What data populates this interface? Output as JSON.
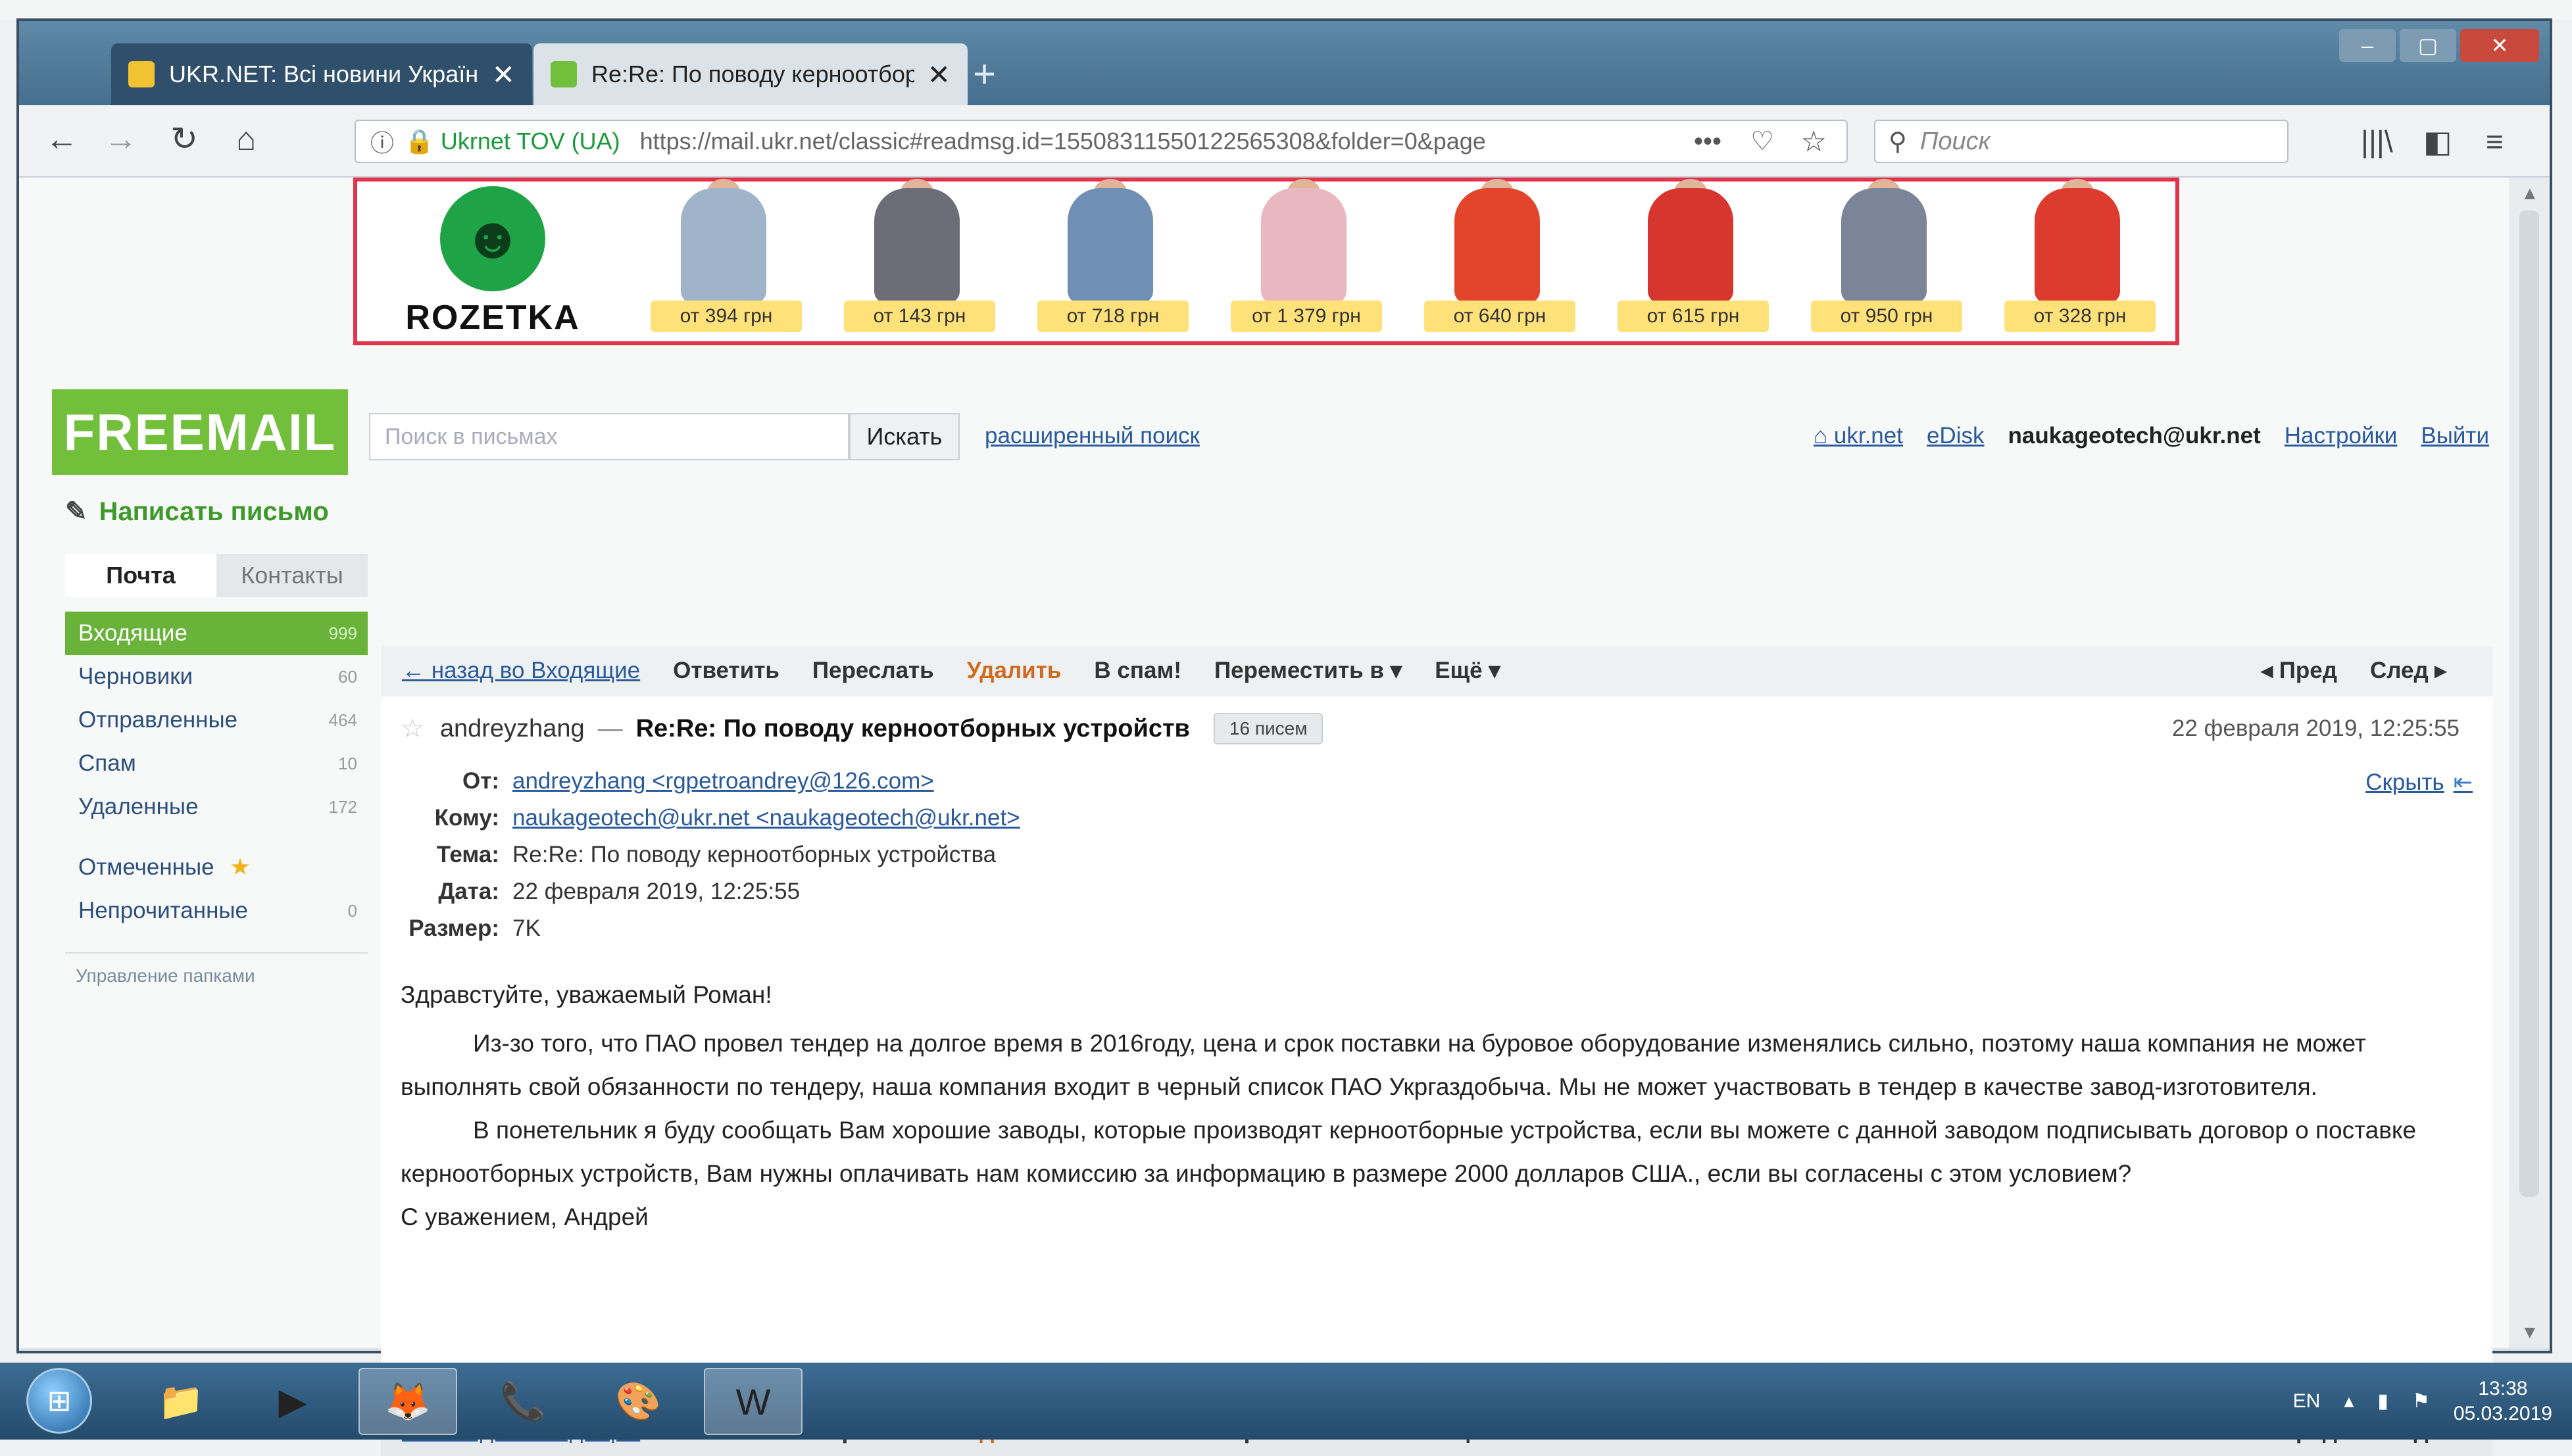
{
  "browser": {
    "tabs": [
      {
        "label": "UKR.NET: Всі новини Україн",
        "close": "✕"
      },
      {
        "label": "Re:Re: По поводу керноотбор",
        "close": "✕"
      }
    ],
    "new_tab": "+",
    "url_org": "Ukrnet TOV (UA)",
    "url": "https://mail.ukr.net/classic#readmsg.id=15508311550122565308&folder=0&page",
    "search_placeholder": "Поиск",
    "icons": [
      "back-icon",
      "forward-icon",
      "reload-icon",
      "home-icon",
      "lock-icon",
      "more-icon",
      "pocket-icon",
      "star-icon",
      "search-icon",
      "library-icon",
      "sidebar-icon",
      "menu-icon"
    ]
  },
  "banner": {
    "brand": "ROZETKA",
    "products": [
      {
        "price": "от 394 грн",
        "color": "#9fb3c9"
      },
      {
        "price": "от 143 грн",
        "color": "#6d6d78"
      },
      {
        "price": "от 718 грн",
        "color": "#6f8fb4"
      },
      {
        "price": "от 1 379 грн",
        "color": "#e9b7c0"
      },
      {
        "price": "от 640 грн",
        "color": "#e2452c"
      },
      {
        "price": "от 615 грн",
        "color": "#d7362e"
      },
      {
        "price": "от 950 грн",
        "color": "#7c8597"
      },
      {
        "price": "от 328 грн",
        "color": "#dd3b2d"
      }
    ]
  },
  "mail": {
    "logo": "FREEMAIL",
    "search_placeholder": "Поиск в письмах",
    "search_button": "Искать",
    "advanced_search": "расширенный поиск",
    "links": {
      "ukrnet": "ukr.net",
      "edisk": "eDisk",
      "user": "naukageotech@ukr.net",
      "settings": "Настройки",
      "logout": "Выйти"
    },
    "compose": "Написать письмо",
    "tabs": {
      "mail": "Почта",
      "contacts": "Контакты"
    },
    "folders": [
      {
        "label": "Входящие",
        "count": "999"
      },
      {
        "label": "Черновики",
        "count": "60"
      },
      {
        "label": "Отправленные",
        "count": "464"
      },
      {
        "label": "Спам",
        "count": "10"
      },
      {
        "label": "Удаленные",
        "count": "172"
      },
      {
        "label": "Отмеченные",
        "count": ""
      },
      {
        "label": "Непрочитанные",
        "count": "0"
      }
    ],
    "manage": "Управление папками",
    "toolbar": {
      "back": "← назад во Входящие",
      "reply": "Ответить",
      "forward": "Переслать",
      "delete": "Удалить",
      "spam": "В спам!",
      "move": "Переместить в ▾",
      "more": "Ещё ▾",
      "prev": "◂ Пред",
      "next": "След ▸"
    },
    "message": {
      "sender": "andreyzhang",
      "dash": "—",
      "subject": "Re:Re: По поводу керноотборных устройств",
      "thread_count": "16 писем",
      "date": "22 февраля 2019, 12:25:55",
      "hide": "Скрыть",
      "headers": {
        "from_label": "От:",
        "from": "andreyzhang <rgpetroandrey@126.com>",
        "to_label": "Кому:",
        "to": "naukageotech@ukr.net <naukageotech@ukr.net>",
        "subject_label": "Тема:",
        "subject": "Re:Re: По поводу керноотборных устройства",
        "date_label": "Дата:",
        "date": "22 февраля 2019, 12:25:55",
        "size_label": "Размер:",
        "size": "7K"
      },
      "body": {
        "greeting": "Здравстуйте, уважаемый Роман!",
        "p1": "Из-зо того, что ПАО провел тендер на долгое время в 2016году, цена и срок поставки на буровое оборудование изменялись сильно, поэтому наша компания не может выполнять свой обязанности по тендеру, наша компания входит в черный список ПАО Укргаздобыча. Мы не может участвовать в тендер в качестве завод-изготовителя.",
        "p2": "В понетельник я буду сообщать Вам хорошие заводы, которые производят керноотборные устройства, если вы можете с данной заводом подписывать договор о поставке керноотборных устройств, Вам нужны оплачивать нам комиссию за информацию в размере 2000 долларов США., если вы согласены с этом условием?",
        "sign": "С уважением, Андрей"
      }
    }
  },
  "taskbar": {
    "lang": "EN",
    "time": "13:38",
    "date": "05.03.2019"
  }
}
